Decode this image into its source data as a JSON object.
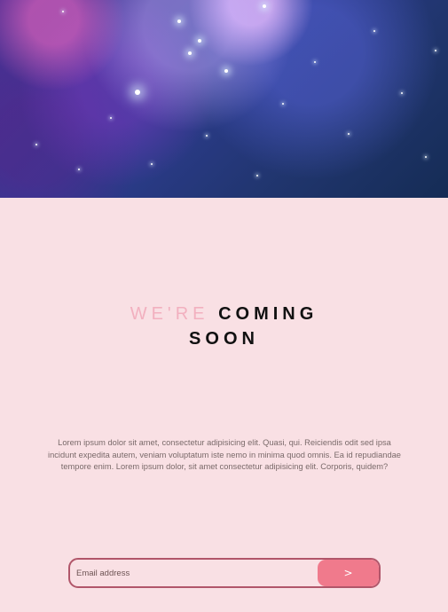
{
  "headline": {
    "accent": "WE'RE ",
    "main_line_1": "COMING",
    "main_line_2": "SOON"
  },
  "body_text": "Lorem ipsum dolor sit amet, consectetur adipisicing elit. Quasi, qui. Reiciendis odit sed ipsa incidunt expedita autem, veniam voluptatum iste nemo in minima quod omnis. Ea id repudiandae tempore enim. Lorem ipsum dolor, sit amet consectetur adipisicing elit. Corporis, quidem?",
  "signup": {
    "placeholder": "Email address",
    "button_label": ">"
  },
  "colors": {
    "page_background": "#f9e0e4",
    "accent_pink": "#f07a8c",
    "border": "#b1566a",
    "heading_accent": "#f2b0bf"
  }
}
